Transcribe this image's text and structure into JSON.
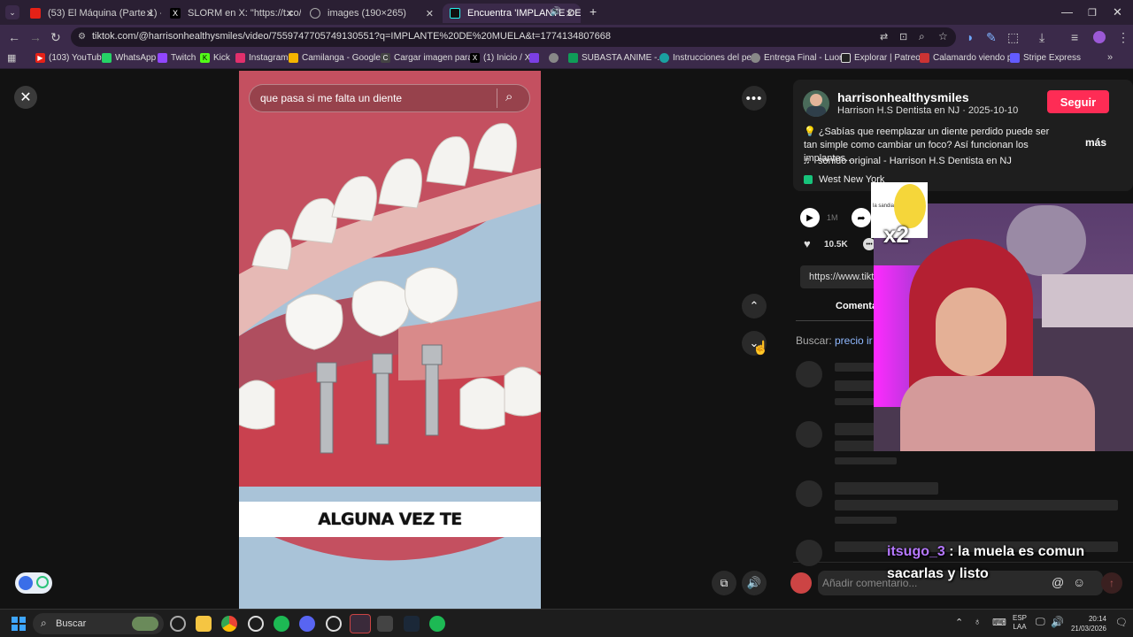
{
  "browser": {
    "tabs": [
      {
        "title": "(53) El Máquina (Parte 1) - YouT",
        "favicon_color": "#e62117",
        "active": false
      },
      {
        "title": "SLORM en X: \"https://t.co/alK2i",
        "favicon_color": "#000000",
        "active": false
      },
      {
        "title": "images (190×265)",
        "favicon_color": "#888888",
        "active": false
      },
      {
        "title": "Encuentra 'IMPLANTE DE M",
        "favicon_color": "#111111",
        "active": true
      }
    ],
    "close_tab": "✕",
    "new_tab": "+",
    "url": "tiktok.com/@harrisonhealthysmiles/video/7559747705749130551?q=IMPLANTE%20DE%20MUELA&t=1774134807668",
    "bookmarks": [
      {
        "label": "(103) YouTube",
        "color": "#e62117"
      },
      {
        "label": "WhatsApp",
        "color": "#25d366"
      },
      {
        "label": "Twitch",
        "color": "#9146ff"
      },
      {
        "label": "Kick",
        "color": "#53fc18"
      },
      {
        "label": "Instagram",
        "color": "#e1306c"
      },
      {
        "label": "Camilanga - Google...",
        "color": "#f4b400"
      },
      {
        "label": "Cargar imagen para...",
        "color": "#444444"
      },
      {
        "label": "(1) Inicio / X",
        "color": "#000000"
      },
      {
        "label": "",
        "color": "#7b3fe4"
      },
      {
        "label": "",
        "color": "#888888"
      },
      {
        "label": "SUBASTA ANIME -...",
        "color": "#0f9d58"
      },
      {
        "label": "Instrucciones del pe...",
        "color": "#1aa1a1"
      },
      {
        "label": "Entrega Final - Luon...",
        "color": "#888888"
      },
      {
        "label": "Explorar | Patreon",
        "color": "#222222"
      },
      {
        "label": "Calamardo viendo p...",
        "color": "#cc3333"
      },
      {
        "label": "Stripe Express",
        "color": "#635bff"
      }
    ]
  },
  "video": {
    "search_text": "que pasa si me falta un diente",
    "caption": "ALGUNA VEZ TE"
  },
  "post": {
    "username": "harrisonhealthysmiles",
    "display_name_date": "Harrison H.S Dentista en NJ · 2025-10-10",
    "follow_label": "Seguir",
    "description": "💡 ¿Sabías que reemplazar un diente perdido puede ser tan simple como cambiar un foco? Así funcionan los implantes...",
    "more_label": "más",
    "sound": "sonido original - Harrison H.S Dentista en NJ",
    "location": "West New York",
    "play_count": "1M",
    "likes": "10.5K",
    "share_url": "https://www.tikt",
    "comments_tab": "Comenta",
    "search_label": "Buscar:",
    "search_suggestion": "precio ir",
    "comment_placeholder": "Añadir comentario..."
  },
  "overlay": {
    "chat_user": "itsugo_3",
    "chat_message": "la muela es comun sacarlas y listo",
    "emote_caption": "x2",
    "emote_label": "la sandia"
  },
  "taskbar": {
    "search_placeholder": "Buscar",
    "lang_top": "ESP",
    "lang_bottom": "LAA",
    "time": "20:14",
    "date": "21/03/2026"
  }
}
